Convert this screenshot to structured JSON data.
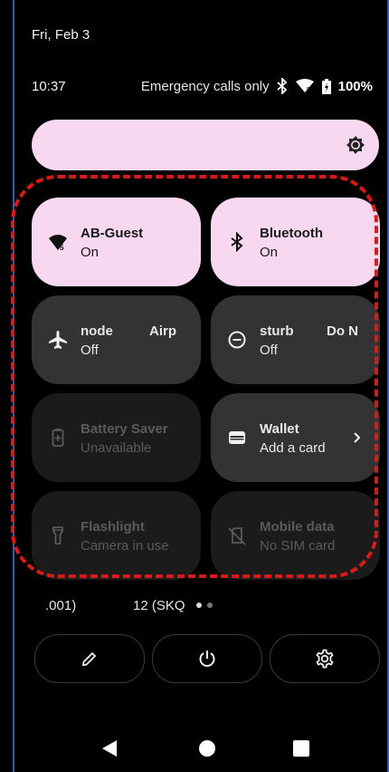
{
  "status_bar": {
    "date": "Fri, Feb 3",
    "time": "10:37",
    "carrier": "Emergency calls only",
    "battery": "100%",
    "icons": [
      "bluetooth-icon",
      "wifi-icon",
      "battery-icon"
    ]
  },
  "brightness": {
    "icon": "brightness-icon"
  },
  "tiles": {
    "wifi": {
      "label": "AB-Guest",
      "state": "On",
      "icon": "wifi-icon"
    },
    "bluetooth": {
      "label": "Bluetooth",
      "state": "On",
      "icon": "bluetooth-icon"
    },
    "airplane": {
      "label_left": "node",
      "label_right": "Airp",
      "state": "Off",
      "icon": "airplane-icon"
    },
    "dnd": {
      "label_left": "sturb",
      "label_right": "Do N",
      "state": "Off",
      "icon": "do-not-disturb-icon"
    },
    "battery_saver": {
      "label": "Battery Saver",
      "state": "Unavailable",
      "icon": "battery-saver-icon"
    },
    "wallet": {
      "label": "Wallet",
      "state": "Add a card",
      "icon": "wallet-icon"
    },
    "flashlight": {
      "label": "Flashlight",
      "state": "Camera in use",
      "icon": "flashlight-icon"
    },
    "mobile_data": {
      "label": "Mobile data",
      "state": "No SIM card",
      "icon": "no-sim-icon"
    }
  },
  "footer": {
    "build_left": ".001)",
    "build_right": "12 (SKQ",
    "buttons": [
      "edit-icon",
      "power-icon",
      "settings-icon"
    ]
  },
  "colors": {
    "active_tile": "#f8d8f0",
    "inactive_tile": "#333235",
    "highlight": "#d91a1a"
  }
}
